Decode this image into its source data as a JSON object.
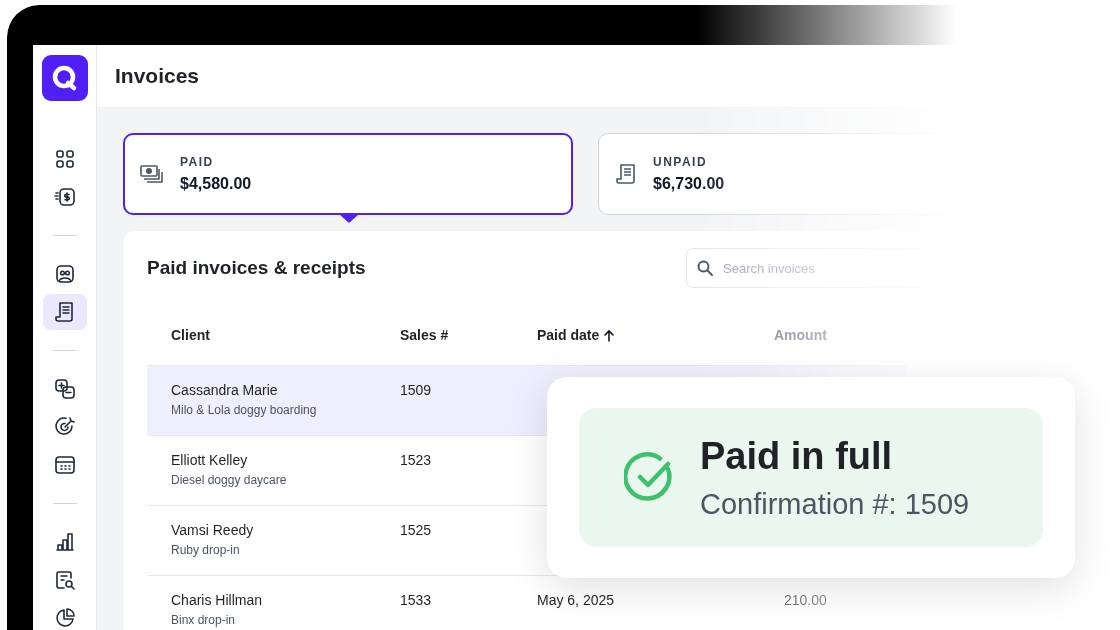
{
  "page": {
    "title": "Invoices"
  },
  "sidebar": {
    "groups": [
      {
        "items": [
          {
            "selected": false
          },
          {
            "selected": false
          }
        ]
      },
      {
        "items": [
          {
            "selected": false
          },
          {
            "selected": true
          }
        ]
      },
      {
        "items": [
          {
            "selected": false
          },
          {
            "selected": false
          },
          {
            "selected": false
          }
        ]
      },
      {
        "items": [
          {
            "selected": false
          },
          {
            "selected": false
          },
          {
            "selected": false
          }
        ]
      }
    ]
  },
  "summary_cards": [
    {
      "label": "PAID",
      "amount": "$4,580.00",
      "selected": true
    },
    {
      "label": "UNPAID",
      "amount": "$6,730.00",
      "selected": false
    }
  ],
  "panel": {
    "title": "Paid invoices & receipts",
    "search": {
      "placeholder": "Search invoices"
    }
  },
  "table": {
    "columns": [
      {
        "label": "Client",
        "sorted": false
      },
      {
        "label": "Sales #",
        "sorted": false
      },
      {
        "label": "Paid date",
        "sorted": true
      },
      {
        "label": "Amount",
        "sorted": false
      }
    ],
    "rows": [
      {
        "client": "Cassandra Marie",
        "detail": "Milo & Lola doggy boarding",
        "sales": "1509",
        "selected": true
      },
      {
        "client": "Elliott Kelley",
        "detail": "Diesel doggy daycare",
        "sales": "1523",
        "selected": false
      },
      {
        "client": "Vamsi Reedy",
        "detail": "Ruby drop-in",
        "sales": "1525",
        "selected": false
      },
      {
        "client": "Charis Hillman",
        "detail": "Binx drop-in",
        "sales": "1533",
        "date": "May 6, 2025",
        "amount": "210.00",
        "selected": false
      }
    ]
  },
  "popup": {
    "title": "Paid in full",
    "confirmation": "Confirmation #: 1509"
  }
}
